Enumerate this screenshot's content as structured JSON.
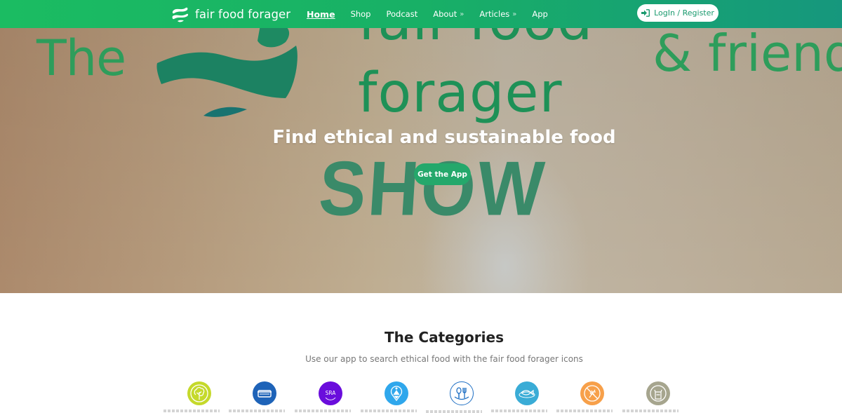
{
  "header": {
    "brand": "fair food forager",
    "nav": [
      {
        "label": "Home",
        "active": true,
        "has_submenu": false
      },
      {
        "label": "Shop",
        "active": false,
        "has_submenu": false
      },
      {
        "label": "Podcast",
        "active": false,
        "has_submenu": false
      },
      {
        "label": "About",
        "active": false,
        "has_submenu": true
      },
      {
        "label": "Articles",
        "active": false,
        "has_submenu": true
      },
      {
        "label": "App",
        "active": false,
        "has_submenu": false
      }
    ],
    "submenu_glyph": "»",
    "login_label": "LogIn / Register",
    "login_icon": "sign-in-icon"
  },
  "hero": {
    "background_text": {
      "the": "The",
      "fair_food": "fair food",
      "forager": "forager",
      "show": "SHOW",
      "friends": "& friends"
    },
    "title": "Find ethical and sustainable food",
    "cta_label": "Get the App"
  },
  "categories": {
    "title": "The Categories",
    "subtitle": "Use our app to search ethical food with the fair food forager icons",
    "items": [
      {
        "icon": "tree-icon",
        "color": "#c5d92b"
      },
      {
        "icon": "container-icon",
        "color": "#1e63b8"
      },
      {
        "icon": "sra-icon",
        "color": "#6a0ddc",
        "text": "SRA"
      },
      {
        "icon": "location-pin-icon",
        "color": "#2fa7ec"
      },
      {
        "icon": "cutlery-icon",
        "color": "#ffffff",
        "stroke": "#1e6fc4"
      },
      {
        "icon": "fish-icon",
        "color": "#3aacd6"
      },
      {
        "icon": "no-wheat-icon",
        "color": "#f7a04a"
      },
      {
        "icon": "no-plastic-bag-icon",
        "color": "#a6a58e"
      }
    ]
  },
  "colors": {
    "brand_green": "#1bbc62",
    "brand_teal": "#16977d",
    "cta_green": "#24a86b"
  }
}
